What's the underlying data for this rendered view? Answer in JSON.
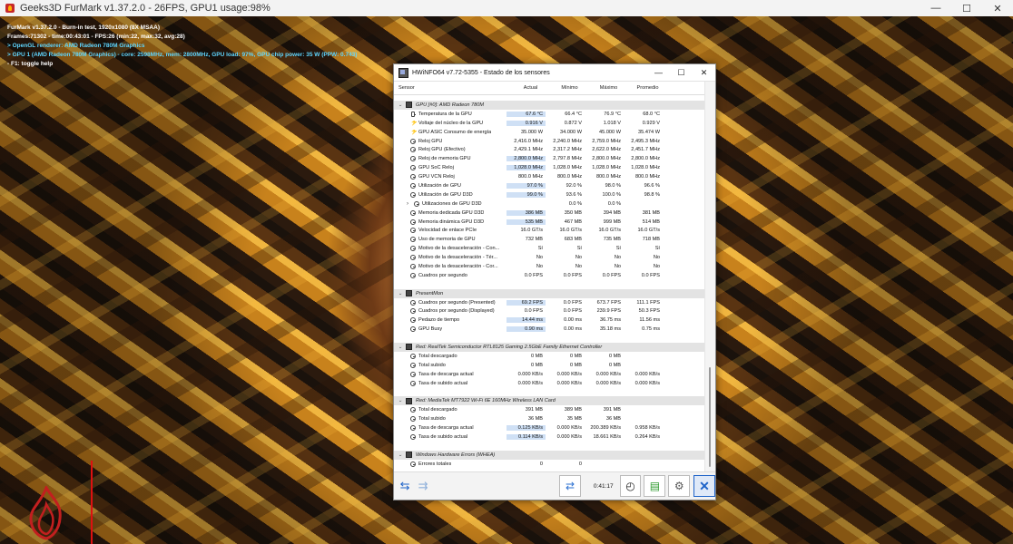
{
  "furmark": {
    "window_title": "Geeks3D FurMark v1.37.2.0 - 26FPS, GPU1 usage:98%",
    "osd": [
      "FurMark v1.37.2.0 - Burn-in test, 1920x1080 (8X MSAA)",
      "Frames:71302 - time:00:43:01 - FPS:26 (min:22, max:32, avg:28)",
      "> OpenGL renderer: AMD Radeon 780M Graphics",
      "> GPU 1 (AMD Radeon 780M Graphics) - core: 2598MHz, mem: 2800MHz, GPU load: 97%, GPU chip power: 35 W (PPW: 0.743)",
      "- F1: toggle help"
    ]
  },
  "hwinfo": {
    "title": "HWiNFO64 v7.72-5355 - Estado de los sensores",
    "columns": [
      "Sensor",
      "Actual",
      "Mínimo",
      "Máximo",
      "Promedio"
    ],
    "groups": [
      {
        "name": "GPU [#0]: AMD Radeon 780M",
        "rows": [
          {
            "name": "Temperatura de la GPU",
            "icon": "thermometer-icon",
            "v": [
              "67.6 °C",
              "66.4 °C",
              "76.9 °C",
              "68.0 °C"
            ],
            "hl": true
          },
          {
            "name": "Voltaje del núcleo de la GPU",
            "icon": "bolt-icon",
            "v": [
              "0.916 V",
              "0.872 V",
              "1.018 V",
              "0.929 V"
            ],
            "hl": true
          },
          {
            "name": "GPU ASIC Consumo de energía",
            "icon": "bolt-icon",
            "v": [
              "35.000 W",
              "34.000 W",
              "45.000 W",
              "35.474 W"
            ],
            "hl": false
          },
          {
            "name": "Reloj GPU",
            "icon": "gauge-icon",
            "v": [
              "2,416.0 MHz",
              "2,240.0 MHz",
              "2,759.0 MHz",
              "2,495.3 MHz"
            ],
            "hl": false
          },
          {
            "name": "Reloj GPU (Efectivo)",
            "icon": "gauge-icon",
            "v": [
              "2,429.1 MHz",
              "2,317.2 MHz",
              "2,622.0 MHz",
              "2,451.7 MHz"
            ],
            "hl": false
          },
          {
            "name": "Reloj de memoria GPU",
            "icon": "gauge-icon",
            "v": [
              "2,800.0 MHz",
              "2,797.8 MHz",
              "2,800.0 MHz",
              "2,800.0 MHz"
            ],
            "hl": true
          },
          {
            "name": "GPU SoC Reloj",
            "icon": "gauge-icon",
            "v": [
              "1,028.0 MHz",
              "1,028.0 MHz",
              "1,028.0 MHz",
              "1,028.0 MHz"
            ],
            "hl": true
          },
          {
            "name": "GPU VCN Reloj",
            "icon": "gauge-icon",
            "v": [
              "800.0 MHz",
              "800.0 MHz",
              "800.0 MHz",
              "800.0 MHz"
            ],
            "hl": false
          },
          {
            "name": "Utilización de GPU",
            "icon": "gauge-icon",
            "v": [
              "97.0 %",
              "92.0 %",
              "98.0 %",
              "96.6 %"
            ],
            "hl": true
          },
          {
            "name": "Utilización de GPU D3D",
            "icon": "gauge-icon",
            "v": [
              "99.0 %",
              "93.6 %",
              "100.0 %",
              "98.8 %"
            ],
            "hl": true
          },
          {
            "name": "Utilizaciones de GPU D3D",
            "icon": "gauge-icon",
            "v": [
              "",
              "0.0 %",
              "0.0 %",
              ""
            ],
            "hl": false,
            "expand": true
          },
          {
            "name": "Memoria dedicada GPU D3D",
            "icon": "gauge-icon",
            "v": [
              "386 MB",
              "350 MB",
              "394 MB",
              "381 MB"
            ],
            "hl": true
          },
          {
            "name": "Memoria dinámica GPU D3D",
            "icon": "gauge-icon",
            "v": [
              "535 MB",
              "467 MB",
              "999 MB",
              "514 MB"
            ],
            "hl": true
          },
          {
            "name": "Velocidad de enlace PCIe",
            "icon": "gauge-icon",
            "v": [
              "16.0 GT/s",
              "16.0 GT/s",
              "16.0 GT/s",
              "16.0 GT/s"
            ],
            "hl": false
          },
          {
            "name": "Uso de memoria de GPU",
            "icon": "gauge-icon",
            "v": [
              "732 MB",
              "683 MB",
              "735 MB",
              "718 MB"
            ],
            "hl": false
          },
          {
            "name": "Motivo de la desaceleración - Con...",
            "icon": "gauge-icon",
            "v": [
              "Sí",
              "Sí",
              "Sí",
              "Sí"
            ],
            "hl": false
          },
          {
            "name": "Motivo de la desaceleración - Tér...",
            "icon": "gauge-icon",
            "v": [
              "No",
              "No",
              "No",
              "No"
            ],
            "hl": false
          },
          {
            "name": "Motivo de la desaceleración - Cor...",
            "icon": "gauge-icon",
            "v": [
              "No",
              "No",
              "No",
              "No"
            ],
            "hl": false
          },
          {
            "name": "Cuadros por segundo",
            "icon": "gauge-icon",
            "v": [
              "0.0 FPS",
              "0.0 FPS",
              "0.0 FPS",
              "0.0 FPS"
            ],
            "hl": false
          }
        ]
      },
      {
        "name": "PresentMon",
        "rows": [
          {
            "name": "Cuadros por segundo (Presented)",
            "icon": "gauge-icon",
            "v": [
              "69.2 FPS",
              "0.0 FPS",
              "673.7 FPS",
              "111.1 FPS"
            ],
            "hl": true
          },
          {
            "name": "Cuadros por segundo (Displayed)",
            "icon": "gauge-icon",
            "v": [
              "0.0 FPS",
              "0.0 FPS",
              "239.9 FPS",
              "50.3 FPS"
            ],
            "hl": false
          },
          {
            "name": "Pedazo de tiempo",
            "icon": "gauge-icon",
            "v": [
              "14.44 ms",
              "0.00 ms",
              "36.75 ms",
              "11.56 ms"
            ],
            "hl": true
          },
          {
            "name": "GPU Busy",
            "icon": "gauge-icon",
            "v": [
              "0.90 ms",
              "0.00 ms",
              "35.18 ms",
              "0.75 ms"
            ],
            "hl": true
          }
        ]
      },
      {
        "name": "Red: RealTek Semiconductor RTL8125 Gaming 2.5GbE Family Ethernet Controller",
        "rows": [
          {
            "name": "Total descargado",
            "icon": "gauge-icon",
            "v": [
              "0 MB",
              "0 MB",
              "0 MB",
              ""
            ],
            "hl": false
          },
          {
            "name": "Total subido",
            "icon": "gauge-icon",
            "v": [
              "0 MB",
              "0 MB",
              "0 MB",
              ""
            ],
            "hl": false
          },
          {
            "name": "Tasa de descarga actual",
            "icon": "gauge-icon",
            "v": [
              "0.000 KB/s",
              "0.000 KB/s",
              "0.000 KB/s",
              "0.000 KB/s"
            ],
            "hl": false
          },
          {
            "name": "Tasa de subido actual",
            "icon": "gauge-icon",
            "v": [
              "0.000 KB/s",
              "0.000 KB/s",
              "0.000 KB/s",
              "0.000 KB/s"
            ],
            "hl": false
          }
        ]
      },
      {
        "name": "Red: MediaTek MT7922 Wi-Fi 6E 160MHz Wireless LAN Card",
        "rows": [
          {
            "name": "Total descargado",
            "icon": "gauge-icon",
            "v": [
              "391 MB",
              "389 MB",
              "391 MB",
              ""
            ],
            "hl": false
          },
          {
            "name": "Total subido",
            "icon": "gauge-icon",
            "v": [
              "36 MB",
              "35 MB",
              "36 MB",
              ""
            ],
            "hl": false
          },
          {
            "name": "Tasa de descarga actual",
            "icon": "gauge-icon",
            "v": [
              "0.125 KB/s",
              "0.000 KB/s",
              "200.389 KB/s",
              "0.958 KB/s"
            ],
            "hl": true
          },
          {
            "name": "Tasa de subido actual",
            "icon": "gauge-icon",
            "v": [
              "0.114 KB/s",
              "0.000 KB/s",
              "18.661 KB/s",
              "0.264 KB/s"
            ],
            "hl": true
          }
        ]
      },
      {
        "name": "Windows Hardware Errors (WHEA)",
        "rows": [
          {
            "name": "Errores totales",
            "icon": "gauge-icon",
            "v": [
              "0",
              "0",
              "",
              ""
            ],
            "hl": false
          }
        ]
      }
    ],
    "footer": {
      "elapsed": "0:41:17"
    },
    "colors": {
      "highlight": "#cfe0f5",
      "group_bg": "#e3e3e3",
      "accent": "#1e63c8"
    }
  }
}
